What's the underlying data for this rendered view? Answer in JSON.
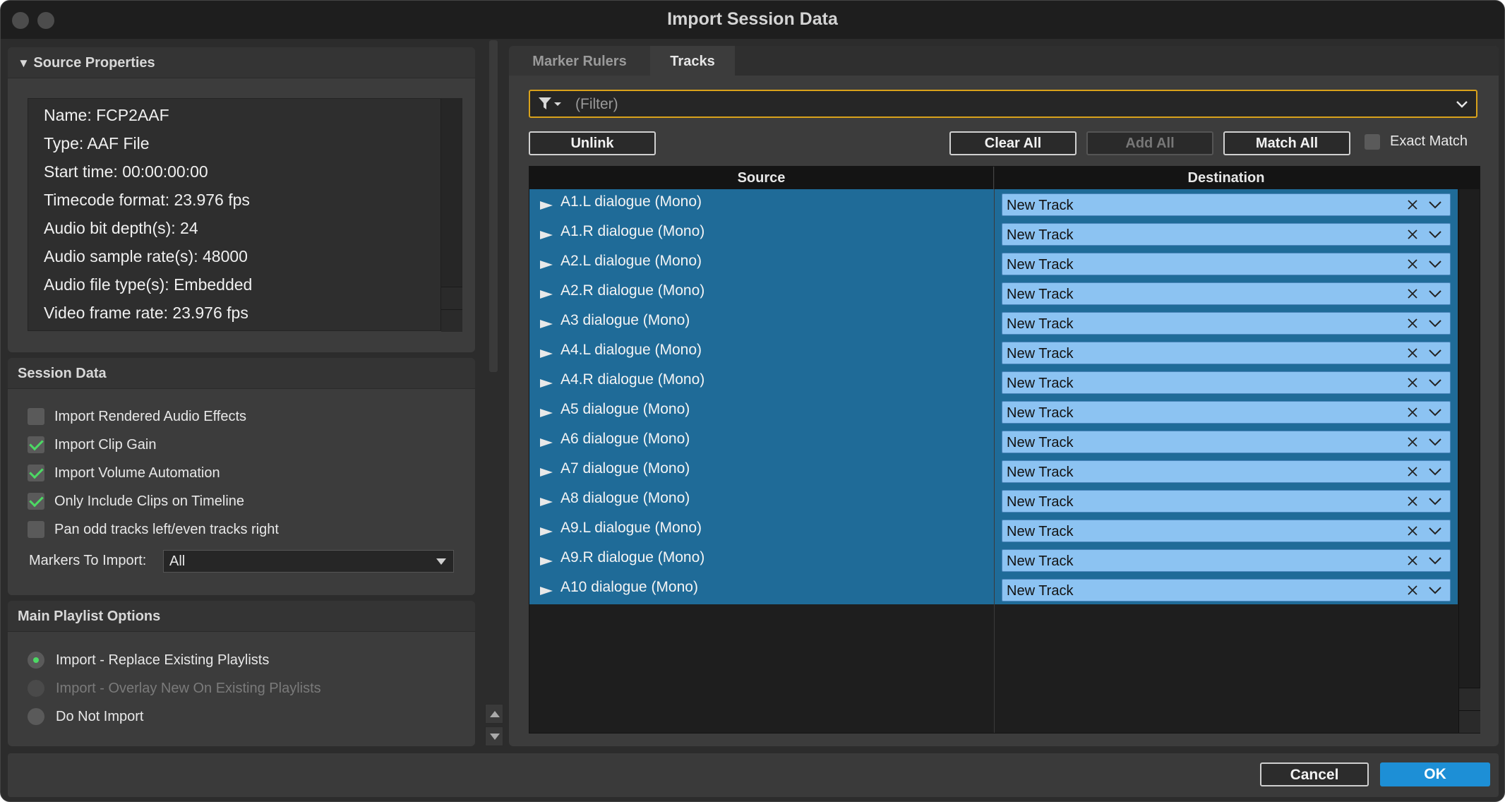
{
  "window": {
    "title": "Import Session Data"
  },
  "source_properties": {
    "header": "Source Properties",
    "lines": [
      "Name: FCP2AAF",
      "Type: AAF File",
      "Start time: 00:00:00:00",
      "Timecode format: 23.976 fps",
      "Audio bit depth(s): 24",
      "Audio sample rate(s): 48000",
      "Audio file type(s): Embedded",
      "Video frame rate: 23.976 fps"
    ]
  },
  "session_data": {
    "header": "Session Data",
    "options": [
      {
        "label": "Import Rendered Audio Effects",
        "checked": false
      },
      {
        "label": "Import Clip Gain",
        "checked": true
      },
      {
        "label": "Import Volume Automation",
        "checked": true
      },
      {
        "label": "Only Include Clips on Timeline",
        "checked": true
      },
      {
        "label": "Pan odd tracks left/even tracks right",
        "checked": false
      }
    ],
    "markers_label": "Markers To Import:",
    "markers_value": "All"
  },
  "main_playlist": {
    "header": "Main Playlist Options",
    "options": [
      {
        "label": "Import - Replace Existing Playlists",
        "selected": true,
        "enabled": true
      },
      {
        "label": "Import - Overlay New On Existing Playlists",
        "selected": false,
        "enabled": false
      },
      {
        "label": "Do Not Import",
        "selected": false,
        "enabled": true
      }
    ]
  },
  "tabs": [
    "Marker Rulers",
    "Tracks"
  ],
  "filter": {
    "placeholder": "(Filter)"
  },
  "buttons": {
    "unlink": "Unlink",
    "clear_all": "Clear All",
    "add_all": "Add All",
    "match_all": "Match All",
    "exact_match": "Exact Match",
    "cancel": "Cancel",
    "ok": "OK"
  },
  "table": {
    "headers": {
      "source": "Source",
      "destination": "Destination"
    },
    "rows": [
      {
        "source": "A1.L dialogue (Mono)",
        "destination": "New Track"
      },
      {
        "source": "A1.R dialogue (Mono)",
        "destination": "New Track"
      },
      {
        "source": "A2.L dialogue (Mono)",
        "destination": "New Track"
      },
      {
        "source": "A2.R dialogue (Mono)",
        "destination": "New Track"
      },
      {
        "source": "A3 dialogue (Mono)",
        "destination": "New Track"
      },
      {
        "source": "A4.L dialogue (Mono)",
        "destination": "New Track"
      },
      {
        "source": "A4.R dialogue (Mono)",
        "destination": "New Track"
      },
      {
        "source": "A5 dialogue (Mono)",
        "destination": "New Track"
      },
      {
        "source": "A6 dialogue (Mono)",
        "destination": "New Track"
      },
      {
        "source": "A7 dialogue (Mono)",
        "destination": "New Track"
      },
      {
        "source": "A8 dialogue (Mono)",
        "destination": "New Track"
      },
      {
        "source": "A9.L dialogue (Mono)",
        "destination": "New Track"
      },
      {
        "source": "A9.R dialogue (Mono)",
        "destination": "New Track"
      },
      {
        "source": "A10 dialogue (Mono)",
        "destination": "New Track"
      }
    ]
  },
  "colors": {
    "accent": "#1d8fd6",
    "selection": "#1f6b98",
    "destination_field": "#8cc3f2",
    "check": "#4cd964",
    "filter_focus": "#d9a21b"
  }
}
